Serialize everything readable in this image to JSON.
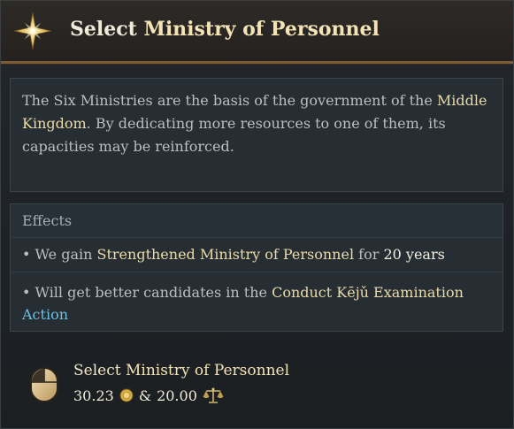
{
  "header": {
    "title_prefix": "Select",
    "title_highlight": "Ministry of Personnel",
    "icon": "gold-star-icon"
  },
  "description": {
    "text_before": "The Six Ministries are the basis of the government of the",
    "link": "Middle Kingdom",
    "text_after": ". By dedicating more resources to one of them, its capacities may be reinforced."
  },
  "effects": {
    "heading": "Effects",
    "items": [
      {
        "bullet": "• We gain",
        "highlight": "Strengthened Ministry of Personnel",
        "middle": "for",
        "value": "20 years"
      },
      {
        "bullet": "• Will get better candidates in the",
        "highlight": "Conduct Kējǔ Examination",
        "link": "Action"
      }
    ]
  },
  "action": {
    "icon": "mouse-icon",
    "label_prefix": "Select",
    "label_highlight": "Ministry of Personnel",
    "cost_gold": "30.23",
    "separator": "&",
    "cost_influence": "20.00",
    "gold_icon": "gold-coin-icon",
    "influence_icon": "scales-icon"
  },
  "colors": {
    "header_border": "#7a5d34",
    "highlight": "#eadba8",
    "link": "#6fbfe2",
    "body_text": "#b9bfc4"
  }
}
